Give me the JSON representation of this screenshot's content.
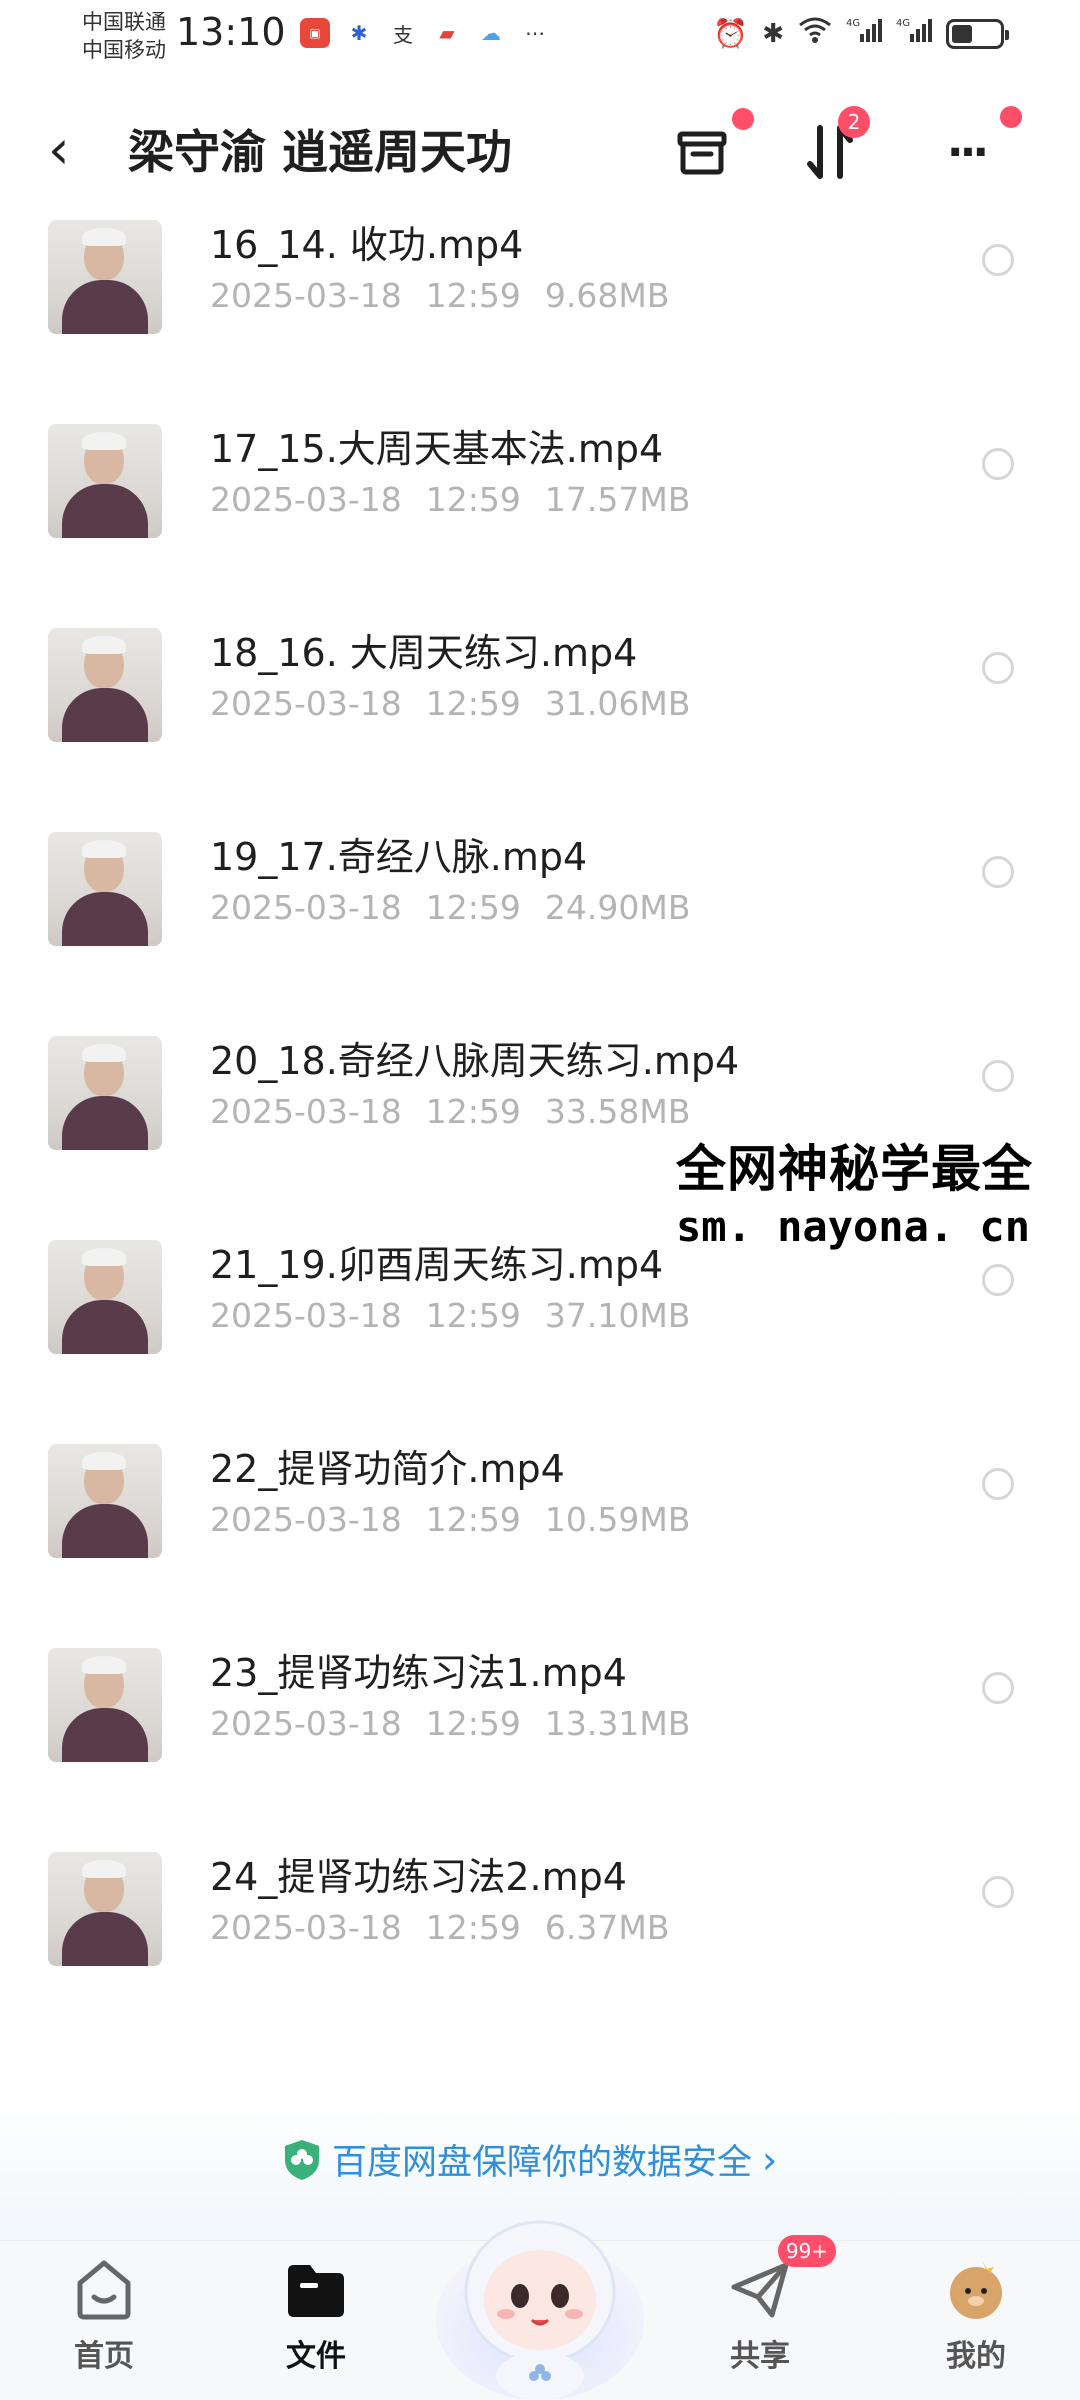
{
  "status_bar": {
    "carrier_1": "中国联通",
    "carrier_2": "中国移动",
    "time": "13:10",
    "notification_icons": [
      "huawei-app-icon",
      "baidu-icon",
      "alipay-icon",
      "reader-icon",
      "baidu-netdisk-icon",
      "more-dots-icon"
    ],
    "system_icons": [
      "alarm-icon",
      "bluetooth-icon",
      "wifi-icon",
      "signal-4g-icon",
      "signal-4g-icon",
      "battery-icon"
    ]
  },
  "header": {
    "back_icon": "‹",
    "title": "梁守渝 逍遥周天功",
    "sort_badge": "2",
    "more_icon": "···"
  },
  "files": [
    {
      "name": "16_14. 收功.mp4",
      "date": "2025-03-18",
      "time": "12:59",
      "size": "9.68MB"
    },
    {
      "name": "17_15.大周天基本法.mp4",
      "date": "2025-03-18",
      "time": "12:59",
      "size": "17.57MB"
    },
    {
      "name": "18_16. 大周天练习.mp4",
      "date": "2025-03-18",
      "time": "12:59",
      "size": "31.06MB"
    },
    {
      "name": "19_17.奇经八脉.mp4",
      "date": "2025-03-18",
      "time": "12:59",
      "size": "24.90MB"
    },
    {
      "name": "20_18.奇经八脉周天练习.mp4",
      "date": "2025-03-18",
      "time": "12:59",
      "size": "33.58MB"
    },
    {
      "name": "21_19.卯酉周天练习.mp4",
      "date": "2025-03-18",
      "time": "12:59",
      "size": "37.10MB"
    },
    {
      "name": "22_提肾功简介.mp4",
      "date": "2025-03-18",
      "time": "12:59",
      "size": "10.59MB"
    },
    {
      "name": "23_提肾功练习法1.mp4",
      "date": "2025-03-18",
      "time": "12:59",
      "size": "13.31MB"
    },
    {
      "name": "24_提肾功练习法2.mp4",
      "date": "2025-03-18",
      "time": "12:59",
      "size": "6.37MB"
    }
  ],
  "watermark": {
    "line1": "全网神秘学最全",
    "line2": "sm. nayona. cn"
  },
  "safety_banner": {
    "text": "百度网盘保障你的数据安全",
    "arrow": "›"
  },
  "bottom_nav": {
    "items": [
      {
        "label": "首页",
        "icon": "home-icon"
      },
      {
        "label": "文件",
        "icon": "folder-icon"
      },
      {
        "label": "共享",
        "icon": "share-icon"
      },
      {
        "label": "我的",
        "icon": "profile-icon"
      }
    ],
    "share_badge": "99+"
  },
  "colors": {
    "accent_blue": "#2f8fd8",
    "badge_red": "#ff4d6a",
    "meta_gray": "#b4b4b4"
  }
}
